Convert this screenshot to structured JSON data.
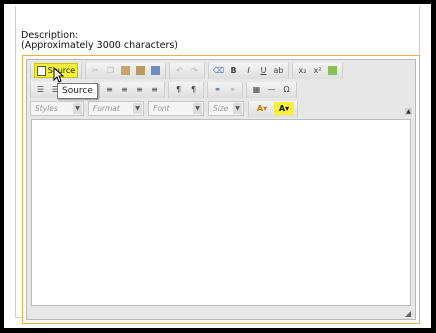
{
  "description": {
    "label": "Description:",
    "hint": "(Approximately 3000 characters)"
  },
  "toolbar": {
    "source_label": "Source",
    "bold": "B",
    "italic": "I",
    "underline": "U",
    "subscript": "x₂",
    "superscript": "x²"
  },
  "combos": {
    "styles": "Styles",
    "format": "Format",
    "font": "Font",
    "size": "Size"
  },
  "tooltip": "Source",
  "colors": {
    "accent_border": "#e8b24a",
    "source_highlight": "#f2ef3c"
  }
}
